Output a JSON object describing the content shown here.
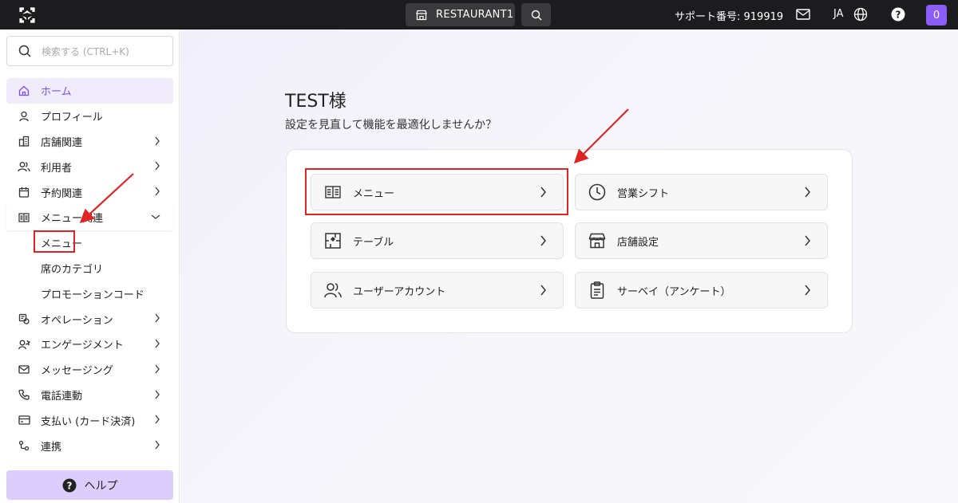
{
  "topbar": {
    "store_name": "RESTAURANT1",
    "support_label": "サポート番号: 919919",
    "language": "JA",
    "avatar_initial": "0"
  },
  "sidebar": {
    "search_placeholder": "検索する (CTRL+K)",
    "items": [
      {
        "label": "ホーム",
        "icon": "home-icon"
      },
      {
        "label": "プロフィール",
        "icon": "user-icon"
      },
      {
        "label": "店舗関連",
        "icon": "building-icon"
      },
      {
        "label": "利用者",
        "icon": "users-icon"
      },
      {
        "label": "予約関連",
        "icon": "calendar-icon"
      },
      {
        "label": "メニュー関連",
        "icon": "menu-book-icon"
      },
      {
        "label": "メニュー"
      },
      {
        "label": "席のカテゴリ"
      },
      {
        "label": "プロモーションコード"
      },
      {
        "label": "オペレーション",
        "icon": "operations-icon"
      },
      {
        "label": "エンゲージメント",
        "icon": "engagement-icon"
      },
      {
        "label": "メッセージング",
        "icon": "mail-icon"
      },
      {
        "label": "電話連動",
        "icon": "phone-icon"
      },
      {
        "label": "支払い (カード決済)",
        "icon": "card-icon"
      },
      {
        "label": "連携",
        "icon": "integration-icon"
      }
    ],
    "help_label": "ヘルプ"
  },
  "main": {
    "greeting": "TEST様",
    "subtitle": "設定を見直して機能を最適化しませんか？",
    "tiles": [
      {
        "label": "メニュー",
        "icon": "menu-book-icon"
      },
      {
        "label": "営業シフト",
        "icon": "clock-icon"
      },
      {
        "label": "テーブル",
        "icon": "table-layout-icon"
      },
      {
        "label": "店舗設定",
        "icon": "storefront-icon"
      },
      {
        "label": "ユーザーアカウント",
        "icon": "users-icon"
      },
      {
        "label": "サーベイ（アンケート）",
        "icon": "clipboard-icon"
      }
    ]
  },
  "colors": {
    "accent": "#8b5cf6",
    "annotation_red": "#e02424",
    "topbar_bg": "#1c1c1e"
  }
}
